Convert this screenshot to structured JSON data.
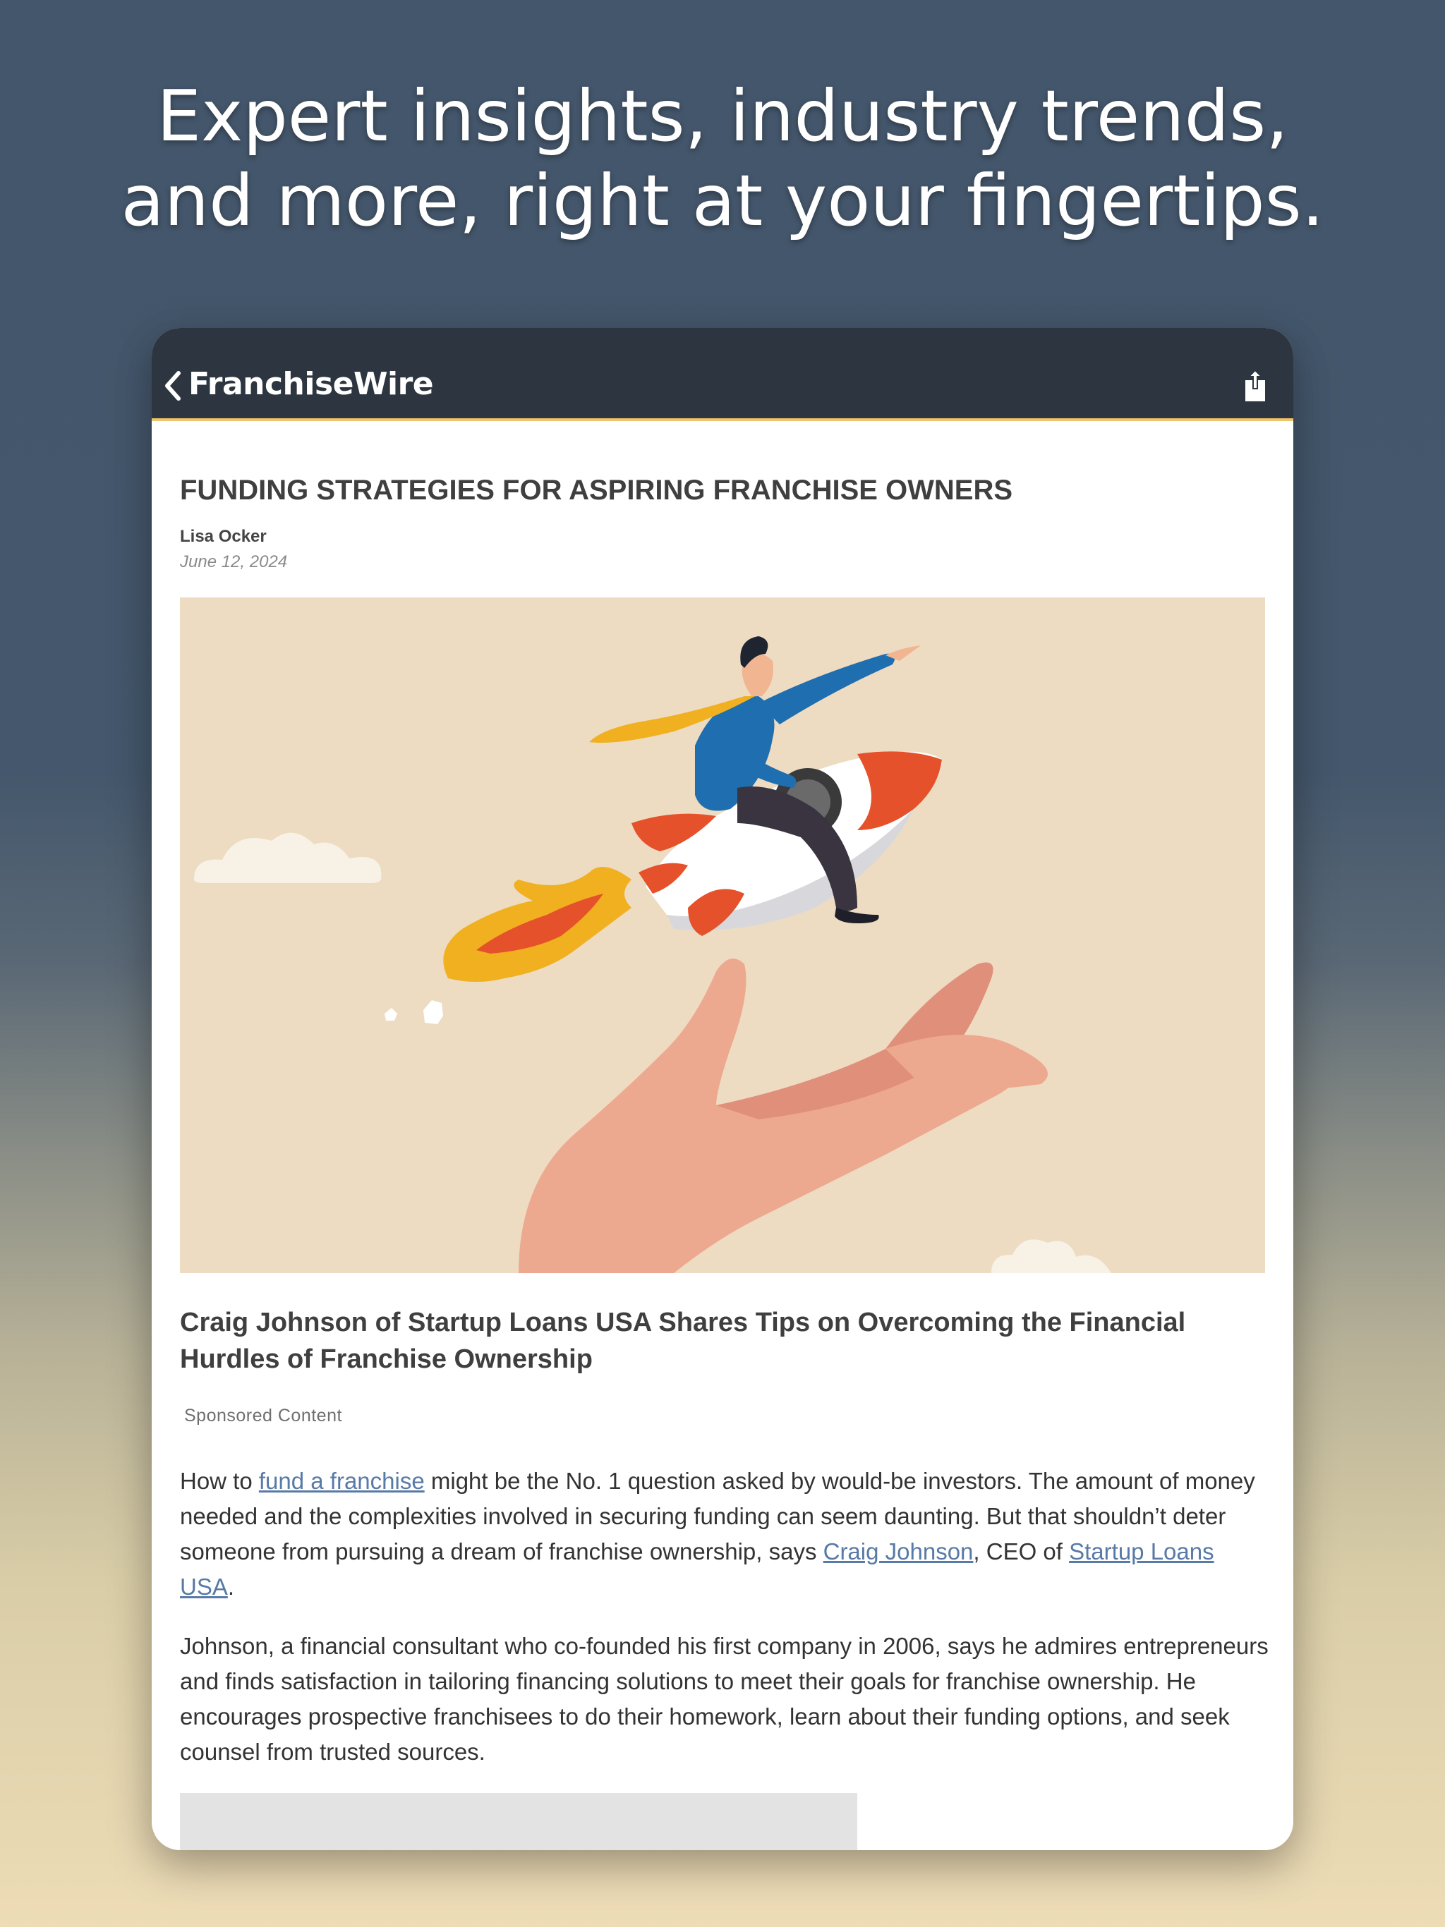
{
  "headline": {
    "line1": "Expert insights, industry trends,",
    "line2": "and more, right at your fingertips."
  },
  "navbar": {
    "brand": "FranchiseWire",
    "back_icon": "chevron-left-icon",
    "share_icon": "share-icon"
  },
  "article": {
    "title": "FUNDING STRATEGIES FOR ASPIRING FRANCHISE OWNERS",
    "author": "Lisa Ocker",
    "date": "June 12, 2024",
    "subtitle": "Craig Johnson of Startup Loans USA Shares Tips on Overcoming the Financial Hurdles of Franchise Ownership",
    "sponsored": "Sponsored Content",
    "p1": {
      "t1": "How to ",
      "link1": "fund a franchise",
      "t2": " might be the No. 1 question asked by would-be investors. The amount of money needed and the complexities involved in securing funding can seem daunting. But that shouldn’t deter someone from pursuing a dream of franchise ownership, says ",
      "link2": "Craig Johnson",
      "t3": ", CEO of ",
      "link3": "Startup Loans USA",
      "t4": "."
    },
    "p2": "Johnson, a financial consultant who co-founded his first company in 2006, says he admires entrepreneurs and finds satisfaction in tailoring financing solutions to meet their goals for franchise ownership. He encourages prospective franchisees to do their homework, learn about their funding options, and seek counsel from trusted sources."
  },
  "colors": {
    "navbar": "#2c3540",
    "accent_line": "#f0c46c",
    "link": "#587aa6",
    "hero_bg": "#eddcc2"
  }
}
